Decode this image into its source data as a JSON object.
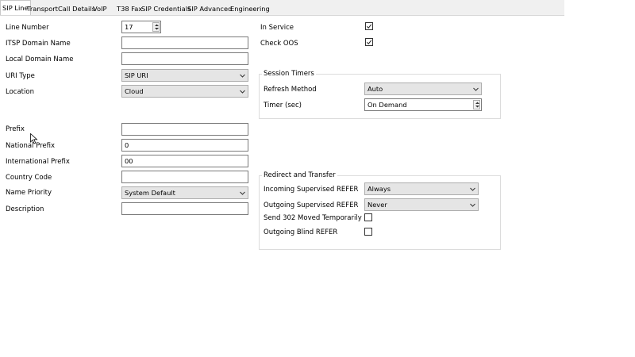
{
  "tabs": [
    {
      "label": "SIP Line",
      "active": true
    },
    {
      "label": "Transport"
    },
    {
      "label": "Call Details"
    },
    {
      "label": "VoIP"
    },
    {
      "label": "T38 Fax"
    },
    {
      "label": "SIP Credentials"
    },
    {
      "label": "SIP Advanced"
    },
    {
      "label": "Engineering"
    }
  ],
  "form": {
    "line_number": {
      "label": "Line Number",
      "value": "17"
    },
    "itsp_domain": {
      "label": "ITSP Domain Name",
      "value": ""
    },
    "local_domain": {
      "label": "Local Domain Name",
      "value": ""
    },
    "uri_type": {
      "label": "URI Type",
      "value": "SIP URI"
    },
    "location": {
      "label": "Location",
      "value": "Cloud"
    },
    "prefix": {
      "label": "Prefix",
      "value": ""
    },
    "national_prefix": {
      "label": "National Prefix",
      "value": "0"
    },
    "international_prefix": {
      "label": "International Prefix",
      "value": "00"
    },
    "country_code": {
      "label": "Country Code",
      "value": ""
    },
    "name_priority": {
      "label": "Name Priority",
      "value": "System Default"
    },
    "description": {
      "label": "Description",
      "value": ""
    },
    "in_service": {
      "label": "In Service",
      "checked": true
    },
    "check_oos": {
      "label": "Check OOS",
      "checked": true
    }
  },
  "session_timers": {
    "title": "Session Timers",
    "refresh_method": {
      "label": "Refresh Method",
      "value": "Auto"
    },
    "timer": {
      "label": "Timer (sec)",
      "value": "On Demand"
    }
  },
  "redirect_transfer": {
    "title": "Redirect and Transfer",
    "incoming_supervised_refer": {
      "label": "Incoming Supervised REFER",
      "value": "Always"
    },
    "outgoing_supervised_refer": {
      "label": "Outgoing Supervised REFER",
      "value": "Never"
    },
    "send_302": {
      "label": "Send 302 Moved Temporarily",
      "checked": false
    },
    "outgoing_blind_refer": {
      "label": "Outgoing Blind REFER",
      "checked": false
    }
  },
  "icons": {
    "dropdown": "chevron-down-icon",
    "spin": "spin-up-down-icon",
    "check": "check-icon",
    "cursor": "mouse-cursor-icon"
  },
  "colors": {
    "tabstrip_bg": "#f0f0f0",
    "combo_bg": "#e5e5e5",
    "input_border": "#7a7a7a",
    "group_border": "#dcdcdc"
  }
}
